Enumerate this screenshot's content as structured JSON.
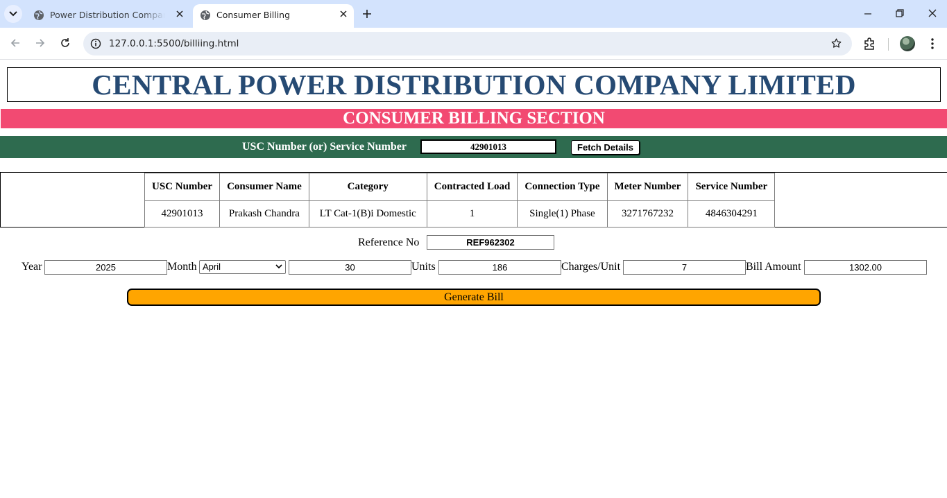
{
  "browser": {
    "tabs": [
      {
        "title": "Power Distribution Company Limited",
        "active": false
      },
      {
        "title": "Consumer Billing",
        "active": true
      }
    ],
    "url": "127.0.0.1:5500/billiing.html"
  },
  "header": {
    "company_name": "CENTRAL POWER DISTRIBUTION COMPANY LIMITED",
    "section_title": "CONSUMER BILLING SECTION"
  },
  "lookup": {
    "label": "USC Number (or) Service Number",
    "value": "42901013",
    "button": "Fetch Details"
  },
  "consumer_table": {
    "headers": [
      "USC Number",
      "Consumer Name",
      "Category",
      "Contracted Load",
      "Connection Type",
      "Meter Number",
      "Service Number"
    ],
    "row": [
      "42901013",
      "Prakash Chandra",
      "LT Cat-1(B)i Domestic",
      "1",
      "Single(1) Phase",
      "3271767232",
      "4846304291"
    ]
  },
  "billing": {
    "reference_label": "Reference No",
    "reference_value": "REF962302",
    "year_label": "Year",
    "year_value": "2025",
    "month_label": "Month",
    "month_value": "April",
    "days_value": "30",
    "units_label": "Units",
    "units_value": "186",
    "charges_label": "Charges/Unit",
    "charges_value": "7",
    "amount_label": "Bill Amount",
    "amount_value": "1302.00",
    "generate_button": "Generate Bill"
  },
  "colors": {
    "title_blue": "#264a73",
    "section_pink": "#f24a72",
    "lookup_green": "#2e6b4f",
    "generate_orange": "#ffa500"
  }
}
